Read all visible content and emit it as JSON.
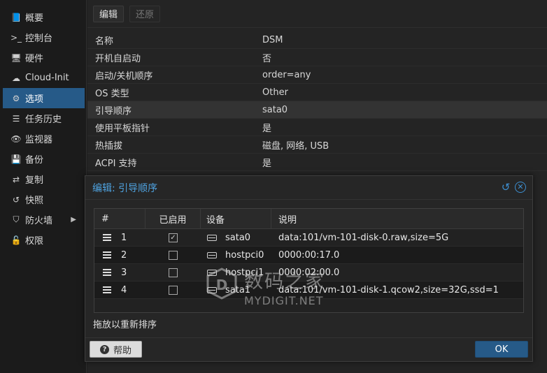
{
  "sidebar": {
    "items": [
      {
        "label": "概要",
        "icon": "book-icon",
        "glyph": "📘"
      },
      {
        "label": "控制台",
        "icon": "terminal-icon",
        "glyph": ">_"
      },
      {
        "label": "硬件",
        "icon": "monitor-icon",
        "glyph": "🖥"
      },
      {
        "label": "Cloud-Init",
        "icon": "cloud-icon",
        "glyph": "☁"
      },
      {
        "label": "选项",
        "icon": "gear-icon",
        "glyph": "⚙",
        "active": true
      },
      {
        "label": "任务历史",
        "icon": "list-icon",
        "glyph": "☰"
      },
      {
        "label": "监视器",
        "icon": "eye-icon",
        "glyph": "👁"
      },
      {
        "label": "备份",
        "icon": "floppy-icon",
        "glyph": "💾"
      },
      {
        "label": "复制",
        "icon": "retweet-icon",
        "glyph": "⇄"
      },
      {
        "label": "快照",
        "icon": "history-icon",
        "glyph": "↺"
      },
      {
        "label": "防火墙",
        "icon": "shield-icon",
        "glyph": "⛉",
        "arrow": "▶"
      },
      {
        "label": "权限",
        "icon": "unlock-icon",
        "glyph": "🔓"
      }
    ]
  },
  "toolbar": {
    "edit_label": "编辑",
    "revert_label": "还原"
  },
  "options": [
    {
      "key": "名称",
      "value": "DSM"
    },
    {
      "key": "开机自启动",
      "value": "否"
    },
    {
      "key": "启动/关机顺序",
      "value": "order=any"
    },
    {
      "key": "OS 类型",
      "value": "Other"
    },
    {
      "key": "引导顺序",
      "value": "sata0"
    },
    {
      "key": "使用平板指针",
      "value": "是"
    },
    {
      "key": "热插拔",
      "value": "磁盘, 网络, USB"
    },
    {
      "key": "ACPI 支持",
      "value": "是"
    }
  ],
  "dialog": {
    "title": "编辑: 引导顺序",
    "columns": {
      "num": "#",
      "enabled": "已启用",
      "device": "设备",
      "desc": "说明"
    },
    "rows": [
      {
        "num": "1",
        "enabled": true,
        "device": "sata0",
        "desc": "data:101/vm-101-disk-0.raw,size=5G"
      },
      {
        "num": "2",
        "enabled": false,
        "device": "hostpci0",
        "desc": "0000:00:17.0"
      },
      {
        "num": "3",
        "enabled": false,
        "device": "hostpci1",
        "desc": "0000:02:00.0"
      },
      {
        "num": "4",
        "enabled": false,
        "device": "sata1",
        "desc": "data:101/vm-101-disk-1.qcow2,size=32G,ssd=1"
      }
    ],
    "hint": "拖放以重新排序",
    "help_label": "帮助",
    "ok_label": "OK"
  },
  "watermark": {
    "cn": "数码之家",
    "en": "MYDIGIT.NET"
  },
  "colors": {
    "accent": "#265a88",
    "title_blue": "#4fa3e0"
  }
}
